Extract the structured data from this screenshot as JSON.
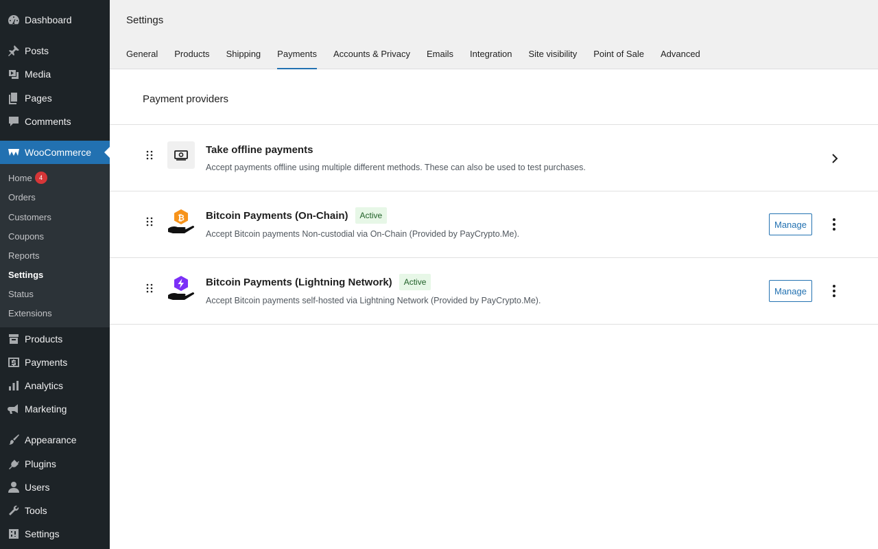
{
  "sidebar": {
    "top_items": [
      {
        "label": "Dashboard",
        "icon": "dashboard-icon"
      },
      {
        "label": "Posts",
        "icon": "pin-icon"
      },
      {
        "label": "Media",
        "icon": "media-icon"
      },
      {
        "label": "Pages",
        "icon": "pages-icon"
      },
      {
        "label": "Comments",
        "icon": "comment-icon"
      }
    ],
    "woocommerce": {
      "label": "WooCommerce",
      "icon": "woocommerce-icon"
    },
    "submenu": [
      {
        "label": "Home",
        "badge": "4"
      },
      {
        "label": "Orders"
      },
      {
        "label": "Customers"
      },
      {
        "label": "Coupons"
      },
      {
        "label": "Reports"
      },
      {
        "label": "Settings",
        "current": true
      },
      {
        "label": "Status"
      },
      {
        "label": "Extensions"
      }
    ],
    "bottom_items": [
      {
        "label": "Products",
        "icon": "archive-icon"
      },
      {
        "label": "Payments",
        "icon": "dollar-icon"
      },
      {
        "label": "Analytics",
        "icon": "bar-chart-icon"
      },
      {
        "label": "Marketing",
        "icon": "megaphone-icon"
      },
      {
        "label": "Appearance",
        "icon": "brush-icon"
      },
      {
        "label": "Plugins",
        "icon": "plug-icon"
      },
      {
        "label": "Users",
        "icon": "user-icon"
      },
      {
        "label": "Tools",
        "icon": "wrench-icon"
      },
      {
        "label": "Settings",
        "icon": "settings-icon"
      }
    ]
  },
  "header": {
    "title": "Settings",
    "tabs": [
      "General",
      "Products",
      "Shipping",
      "Payments",
      "Accounts & Privacy",
      "Emails",
      "Integration",
      "Site visibility",
      "Point of Sale",
      "Advanced"
    ],
    "active_tab": "Payments"
  },
  "main": {
    "section_title": "Payment providers",
    "providers": [
      {
        "name": "Take offline payments",
        "description": "Accept payments offline using multiple different methods. These can also be used to test purchases.",
        "icon": "cash-icon"
      },
      {
        "name": "Bitcoin Payments (On-Chain)",
        "status": "Active",
        "description": "Accept Bitcoin payments Non-custodial via On-Chain (Provided by PayCrypto.Me).",
        "manage_label": "Manage",
        "icon": "bitcoin-hand-icon"
      },
      {
        "name": "Bitcoin Payments (Lightning Network)",
        "status": "Active",
        "description": "Accept Bitcoin payments self-hosted via Lightning Network (Provided by PayCrypto.Me).",
        "manage_label": "Manage",
        "icon": "lightning-hand-icon"
      }
    ]
  },
  "colors": {
    "sidebar_bg": "#1d2327",
    "submenu_bg": "#2c3338",
    "accent": "#2271b1",
    "badge": "#d63638",
    "bitcoin_orange": "#f7931a",
    "lightning_purple": "#7b2ff7",
    "active_badge_bg": "#e7f7e7"
  }
}
